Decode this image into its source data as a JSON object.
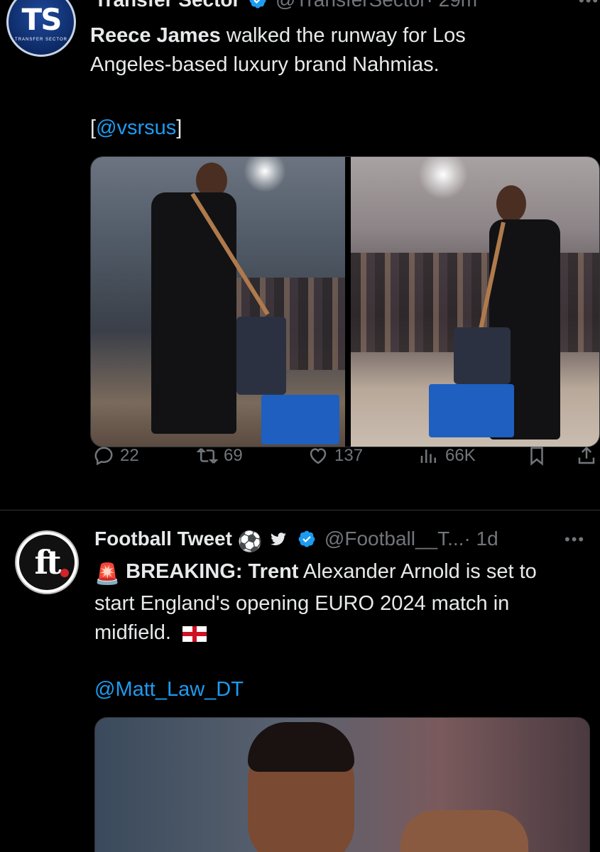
{
  "tweets": [
    {
      "author_name": "Transfer Sector",
      "handle": "@TransferSector",
      "time": "· 29m",
      "avatar_text": "TS",
      "avatar_subtext": "TRANSFER SECTOR",
      "text_bold": "Reece James",
      "text_rest": " walked the runway for Los Angeles-based luxury brand Nahmias.",
      "credit": "[@vsrsus]",
      "stats": {
        "replies": "22",
        "reposts": "69",
        "likes": "137",
        "views": "66K"
      }
    },
    {
      "author_name": "Football Tweet",
      "name_emoji": "⚽",
      "handle": "@Football__T...",
      "time": "· 1d",
      "avatar_text": "ft",
      "siren_emoji": "🚨",
      "text_bold": "BREAKING: Trent",
      "text_rest": " Alexander Arnold is set to start England's opening EURO 2024 match in midfield.",
      "credit": "@Matt_Law_DT"
    }
  ],
  "colors": {
    "background": "#000000",
    "text": "#e7e9ea",
    "muted": "#71767b",
    "link": "#1d9bf0",
    "divider": "#2f3336"
  },
  "icons": [
    "verified-badge-icon",
    "more-icon",
    "reply-icon",
    "repost-icon",
    "like-icon",
    "views-icon",
    "bookmark-icon",
    "share-icon",
    "twitter-bird-icon",
    "soccer-ball-icon",
    "siren-icon",
    "england-flag-icon"
  ]
}
